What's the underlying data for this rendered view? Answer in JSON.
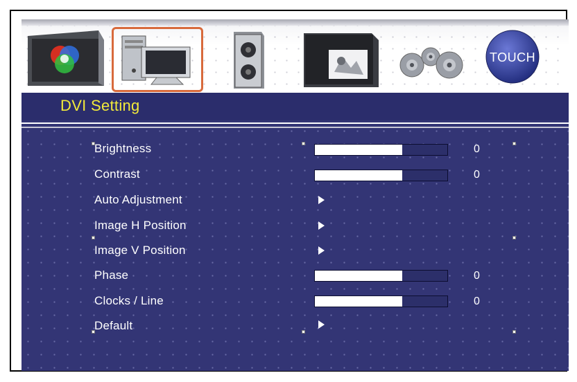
{
  "osd": {
    "icons": [
      {
        "name": "color-icon"
      },
      {
        "name": "pc-icon",
        "selected": true
      },
      {
        "name": "audio-icon"
      },
      {
        "name": "picture-icon"
      },
      {
        "name": "settings-gears-icon"
      },
      {
        "name": "touch-icon",
        "label": "TOUCH"
      }
    ],
    "title": "DVI Setting",
    "items": [
      {
        "label": "Brightness",
        "type": "slider",
        "level_percent": 66,
        "value": "0"
      },
      {
        "label": "Contrast",
        "type": "slider",
        "level_percent": 66,
        "value": "0"
      },
      {
        "label": "Auto Adjustment",
        "type": "submenu"
      },
      {
        "label": "Image H Position",
        "type": "submenu"
      },
      {
        "label": "Image V Position",
        "type": "submenu"
      },
      {
        "label": "Phase",
        "type": "slider",
        "level_percent": 66,
        "value": "0"
      },
      {
        "label": "Clocks / Line",
        "type": "slider",
        "level_percent": 66,
        "value": "0"
      },
      {
        "label": "Default",
        "type": "submenu"
      }
    ],
    "colors": {
      "panel_bg": "#333575",
      "title_bg": "#2b2d6c",
      "title_text": "#f2ea3a",
      "selection_outline": "#d86a3c"
    }
  }
}
